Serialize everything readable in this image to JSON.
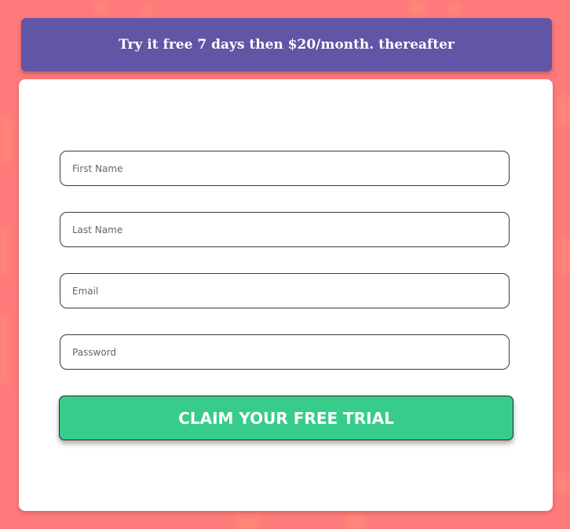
{
  "colors": {
    "page_background": "#ff7a7a",
    "banner_background": "#6155a6",
    "button_background": "#37cc8b",
    "card_background": "#ffffff"
  },
  "banner": {
    "text": "Try it free 7 days then $20/month. thereafter"
  },
  "form": {
    "first_name": {
      "placeholder": "First Name",
      "value": ""
    },
    "last_name": {
      "placeholder": "Last Name",
      "value": ""
    },
    "email": {
      "placeholder": "Email",
      "value": ""
    },
    "password": {
      "placeholder": "Password",
      "value": ""
    },
    "submit_label": "CLAIM YOUR FREE TRIAL"
  }
}
